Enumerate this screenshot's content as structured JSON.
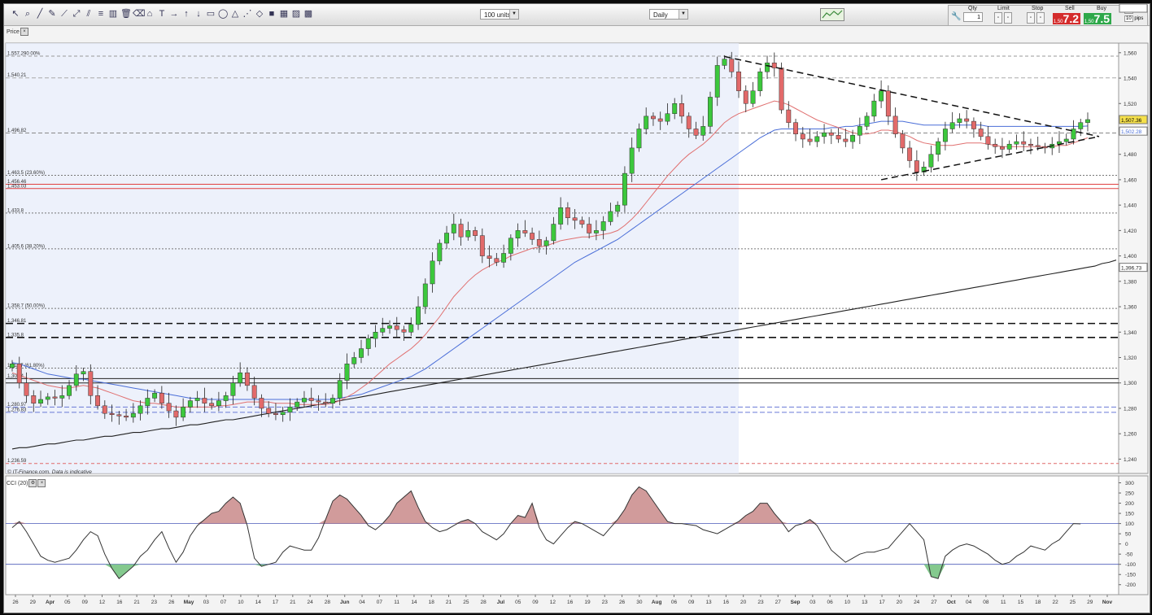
{
  "toolbar": {
    "units_select": "100 units",
    "timeframe_select": "Daily",
    "icons": [
      "cursor-icon",
      "zoom-icon",
      "line-icon",
      "pencil-icon",
      "trend-line-icon",
      "ray-icon",
      "channel-icon",
      "fib-icon",
      "bar-icon",
      "trash-icon",
      "eraser-icon",
      "magnet-icon",
      "text-icon",
      "arrow-right-icon",
      "arrow-up-icon",
      "arrow-down-icon",
      "rectangle-icon",
      "ellipse-icon",
      "triangle-icon",
      "gann-icon",
      "shape-icon",
      "color-icon",
      "palette-icon",
      "theme-icon",
      "layout-icon"
    ]
  },
  "trade_panel": {
    "qty_label": "Qty",
    "qty_value": "1",
    "limit_label": "Limit",
    "stop_label": "Stop",
    "sell_label": "Sell",
    "buy_label": "Buy",
    "sell_prefix": "1,50",
    "sell_big": "7.2",
    "buy_prefix": "1,50",
    "buy_big": "7.5",
    "pips_value_1": "10",
    "pips_label_1": "pips",
    "pips_value_2": "10",
    "pips_label_2": "pips",
    "sell_color": "#d42b2b",
    "buy_color": "#2ea84a"
  },
  "price_panel": {
    "title": "Price",
    "watermark": "© IT-Finance.com. Data is indicative",
    "current_price": "1,507.36",
    "current_price_2": "1,502.28",
    "sma200_value": "1,396.73",
    "level_labels": [
      {
        "text": "1,557.290 00%",
        "price": 1557.29
      },
      {
        "text": "1,540.21",
        "price": 1540.21
      },
      {
        "text": "1,496.82",
        "price": 1496.82
      },
      {
        "text": "1,463.5 (23.60%)",
        "price": 1463.5
      },
      {
        "text": "1,456.46",
        "price": 1456.46
      },
      {
        "text": "1,453.03",
        "price": 1453.03
      },
      {
        "text": "1,433.8",
        "price": 1433.8
      },
      {
        "text": "1,405.6 (38.20%)",
        "price": 1405.6
      },
      {
        "text": "1,358.7 (50.00%)",
        "price": 1358.7
      },
      {
        "text": "1,346.81",
        "price": 1346.81
      },
      {
        "text": "1,335.8",
        "price": 1335.8
      },
      {
        "text": "1,311.7 (61.80%)",
        "price": 1311.7
      },
      {
        "text": "1,303.4",
        "price": 1303.4
      },
      {
        "text": "1,280.97",
        "price": 1280.97
      },
      {
        "text": "1,276.83",
        "price": 1276.83
      },
      {
        "text": "1,236.59",
        "price": 1236.59
      }
    ],
    "y_ticks": [
      "1,560",
      "1,540",
      "1,520",
      "1,500",
      "1,480",
      "1,460",
      "1,440",
      "1,420",
      "1,400",
      "1,380",
      "1,360",
      "1,340",
      "1,320",
      "1,300",
      "1,280",
      "1,260",
      "1,240"
    ]
  },
  "cci_panel": {
    "title": "CCI (20)",
    "current_value": "98.551",
    "y_ticks": [
      "300",
      "250",
      "200",
      "150",
      "100",
      "50",
      "0",
      "-50",
      "-100",
      "-150",
      "-200"
    ]
  },
  "x_axis": {
    "labels": [
      "26",
      "29",
      "Apr",
      "05",
      "09",
      "12",
      "16",
      "21",
      "23",
      "26",
      "May",
      "03",
      "07",
      "10",
      "14",
      "17",
      "21",
      "24",
      "28",
      "Jun",
      "04",
      "07",
      "11",
      "14",
      "18",
      "21",
      "25",
      "28",
      "Jul",
      "05",
      "09",
      "12",
      "16",
      "19",
      "23",
      "26",
      "30",
      "Aug",
      "06",
      "09",
      "13",
      "16",
      "20",
      "23",
      "27",
      "Sep",
      "03",
      "06",
      "10",
      "13",
      "17",
      "20",
      "24",
      "27",
      "Oct",
      "04",
      "08",
      "11",
      "15",
      "18",
      "22",
      "25",
      "29",
      "Nov"
    ],
    "bold_labels": [
      "Apr",
      "May",
      "Jun",
      "Jul",
      "Aug",
      "Sep",
      "Oct",
      "Nov"
    ]
  },
  "chart_data": {
    "type": "candlestick",
    "title": "",
    "ylim": [
      1230,
      1565
    ],
    "cci_ylim": [
      -225,
      310
    ],
    "up_color": "#3cc83c",
    "down_color": "#e26a6a",
    "closes": [
      1315,
      1300,
      1290,
      1284,
      1287,
      1289,
      1288,
      1290,
      1298,
      1307,
      1309,
      1290,
      1282,
      1276,
      1275,
      1274,
      1273,
      1276,
      1282,
      1288,
      1292,
      1284,
      1278,
      1273,
      1281,
      1286,
      1288,
      1284,
      1282,
      1286,
      1290,
      1300,
      1308,
      1298,
      1288,
      1280,
      1276,
      1275,
      1277,
      1281,
      1285,
      1288,
      1286,
      1285,
      1284,
      1288,
      1302,
      1315,
      1320,
      1327,
      1335,
      1340,
      1343,
      1345,
      1342,
      1340,
      1346,
      1360,
      1378,
      1396,
      1410,
      1418,
      1425,
      1415,
      1420,
      1416,
      1400,
      1398,
      1395,
      1402,
      1414,
      1420,
      1418,
      1413,
      1408,
      1412,
      1425,
      1438,
      1430,
      1428,
      1425,
      1418,
      1420,
      1427,
      1435,
      1440,
      1465,
      1485,
      1500,
      1510,
      1508,
      1506,
      1512,
      1520,
      1510,
      1500,
      1495,
      1502,
      1525,
      1550,
      1555,
      1545,
      1530,
      1520,
      1530,
      1545,
      1552,
      1548,
      1515,
      1505,
      1496,
      1492,
      1490,
      1494,
      1497,
      1495,
      1492,
      1490,
      1495,
      1502,
      1510,
      1522,
      1530,
      1510,
      1496,
      1485,
      1475,
      1466,
      1470,
      1480,
      1490,
      1500,
      1505,
      1508,
      1506,
      1500,
      1494,
      1488,
      1486,
      1484,
      1488,
      1490,
      1488,
      1487,
      1486,
      1485,
      1488,
      1490,
      1492,
      1500,
      1505,
      1507.36
    ],
    "sma20": [
      1308,
      1306,
      1304,
      1302,
      1300,
      1298,
      1297,
      1296,
      1296,
      1297,
      1298,
      1297,
      1296,
      1294,
      1292,
      1290,
      1288,
      1286,
      1285,
      1284,
      1284,
      1283,
      1282,
      1281,
      1281,
      1281,
      1281,
      1281,
      1281,
      1282,
      1282,
      1283,
      1284,
      1285,
      1285,
      1285,
      1285,
      1284,
      1284,
      1284,
      1283,
      1283,
      1283,
      1283,
      1283,
      1284,
      1286,
      1289,
      1292,
      1296,
      1300,
      1305,
      1310,
      1315,
      1319,
      1323,
      1327,
      1332,
      1338,
      1345,
      1352,
      1360,
      1368,
      1374,
      1380,
      1385,
      1389,
      1392,
      1395,
      1397,
      1400,
      1402,
      1404,
      1406,
      1407,
      1408,
      1410,
      1412,
      1413,
      1414,
      1415,
      1415,
      1416,
      1417,
      1418,
      1420,
      1424,
      1429,
      1435,
      1442,
      1449,
      1456,
      1463,
      1469,
      1475,
      1480,
      1484,
      1488,
      1493,
      1499,
      1505,
      1509,
      1512,
      1514,
      1516,
      1518,
      1520,
      1522,
      1521,
      1519,
      1516,
      1513,
      1510,
      1507,
      1505,
      1503,
      1501,
      1499,
      1497,
      1496,
      1496,
      1497,
      1499,
      1499,
      1498,
      1496,
      1494,
      1491,
      1489,
      1488,
      1487,
      1487,
      1487,
      1488,
      1489,
      1489,
      1489,
      1488,
      1487,
      1486,
      1486,
      1486,
      1486,
      1486,
      1486,
      1486,
      1486,
      1487,
      1487,
      1489,
      1491,
      1493
    ],
    "sma50": [
      1316,
      1315,
      1313,
      1311,
      1309,
      1307,
      1306,
      1305,
      1304,
      1303,
      1303,
      1302,
      1301,
      1300,
      1299,
      1298,
      1297,
      1296,
      1295,
      1294,
      1293,
      1292,
      1291,
      1290,
      1289,
      1288,
      1288,
      1287,
      1287,
      1287,
      1287,
      1287,
      1287,
      1287,
      1287,
      1287,
      1287,
      1287,
      1287,
      1287,
      1287,
      1287,
      1287,
      1287,
      1287,
      1287,
      1288,
      1289,
      1290,
      1291,
      1293,
      1295,
      1297,
      1299,
      1301,
      1303,
      1305,
      1308,
      1311,
      1315,
      1319,
      1323,
      1327,
      1331,
      1335,
      1339,
      1343,
      1347,
      1351,
      1355,
      1359,
      1363,
      1367,
      1371,
      1375,
      1379,
      1383,
      1387,
      1391,
      1395,
      1398,
      1401,
      1404,
      1407,
      1410,
      1413,
      1417,
      1421,
      1425,
      1429,
      1433,
      1437,
      1441,
      1445,
      1449,
      1453,
      1457,
      1461,
      1465,
      1469,
      1473,
      1477,
      1481,
      1485,
      1489,
      1493,
      1496,
      1499,
      1500,
      1500,
      1500,
      1500,
      1500,
      1500,
      1500,
      1501,
      1501,
      1502,
      1502,
      1503,
      1504,
      1505,
      1506,
      1506,
      1506,
      1506,
      1505,
      1504,
      1503,
      1503,
      1503,
      1503,
      1503,
      1503,
      1503,
      1503,
      1503,
      1502,
      1502,
      1502,
      1502,
      1502,
      1502,
      1502,
      1502,
      1502,
      1502,
      1502,
      1502,
      1502,
      1502,
      1502.28
    ],
    "sma200": [
      1248,
      1249,
      1249,
      1250,
      1251,
      1252,
      1252,
      1253,
      1254,
      1255,
      1255,
      1256,
      1257,
      1258,
      1258,
      1259,
      1260,
      1261,
      1261,
      1262,
      1263,
      1264,
      1264,
      1265,
      1266,
      1267,
      1267,
      1268,
      1269,
      1270,
      1271,
      1271,
      1272,
      1273,
      1274,
      1275,
      1276,
      1277,
      1278,
      1279,
      1280,
      1281,
      1282,
      1283,
      1284,
      1285,
      1286,
      1287,
      1288,
      1289,
      1290,
      1291,
      1292,
      1293,
      1294,
      1295,
      1296,
      1297,
      1298,
      1299,
      1300,
      1301,
      1302,
      1303,
      1304,
      1305,
      1306,
      1307,
      1308,
      1309,
      1310,
      1311,
      1312,
      1313,
      1314,
      1315,
      1316,
      1317,
      1318,
      1319,
      1320,
      1321,
      1322,
      1323,
      1324,
      1325,
      1326,
      1327,
      1328,
      1329,
      1330,
      1331,
      1332,
      1333,
      1334,
      1335,
      1336,
      1337,
      1338,
      1339,
      1340,
      1341,
      1342,
      1343,
      1344,
      1345,
      1346,
      1347,
      1348,
      1349,
      1350,
      1351,
      1352,
      1353,
      1354,
      1355,
      1356,
      1357,
      1358,
      1359,
      1360,
      1361,
      1362,
      1363,
      1364,
      1365,
      1366,
      1367,
      1368,
      1369,
      1370,
      1371,
      1372,
      1373,
      1374,
      1375,
      1376,
      1377,
      1378,
      1379,
      1380,
      1381,
      1382,
      1383,
      1384,
      1385,
      1386,
      1387,
      1388,
      1389,
      1390,
      1391,
      1392,
      1394,
      1395,
      1396.73
    ],
    "cci": [
      80,
      110,
      60,
      0,
      -60,
      -80,
      -90,
      -80,
      -70,
      -30,
      20,
      60,
      40,
      -50,
      -120,
      -170,
      -140,
      -110,
      -60,
      -30,
      20,
      60,
      -20,
      -90,
      -40,
      40,
      90,
      120,
      150,
      160,
      200,
      230,
      200,
      90,
      -70,
      -110,
      -100,
      -90,
      -40,
      -10,
      -20,
      -30,
      -30,
      30,
      120,
      210,
      240,
      220,
      180,
      140,
      90,
      70,
      100,
      140,
      200,
      230,
      260,
      180,
      110,
      80,
      60,
      70,
      90,
      110,
      120,
      100,
      60,
      40,
      20,
      50,
      100,
      140,
      130,
      200,
      80,
      20,
      0,
      40,
      80,
      110,
      100,
      80,
      60,
      40,
      80,
      120,
      170,
      240,
      280,
      260,
      210,
      160,
      110,
      100,
      100,
      95,
      90,
      70,
      60,
      50,
      70,
      90,
      110,
      140,
      160,
      200,
      200,
      150,
      110,
      60,
      90,
      100,
      120,
      90,
      30,
      -30,
      -60,
      -90,
      -70,
      -50,
      -40,
      -40,
      -30,
      -20,
      20,
      60,
      100,
      60,
      20,
      -160,
      -170,
      -60,
      -30,
      -10,
      0,
      -10,
      -30,
      -50,
      -80,
      -100,
      -90,
      -60,
      -40,
      -10,
      -20,
      -30,
      0,
      20,
      60,
      100,
      98.551
    ]
  }
}
